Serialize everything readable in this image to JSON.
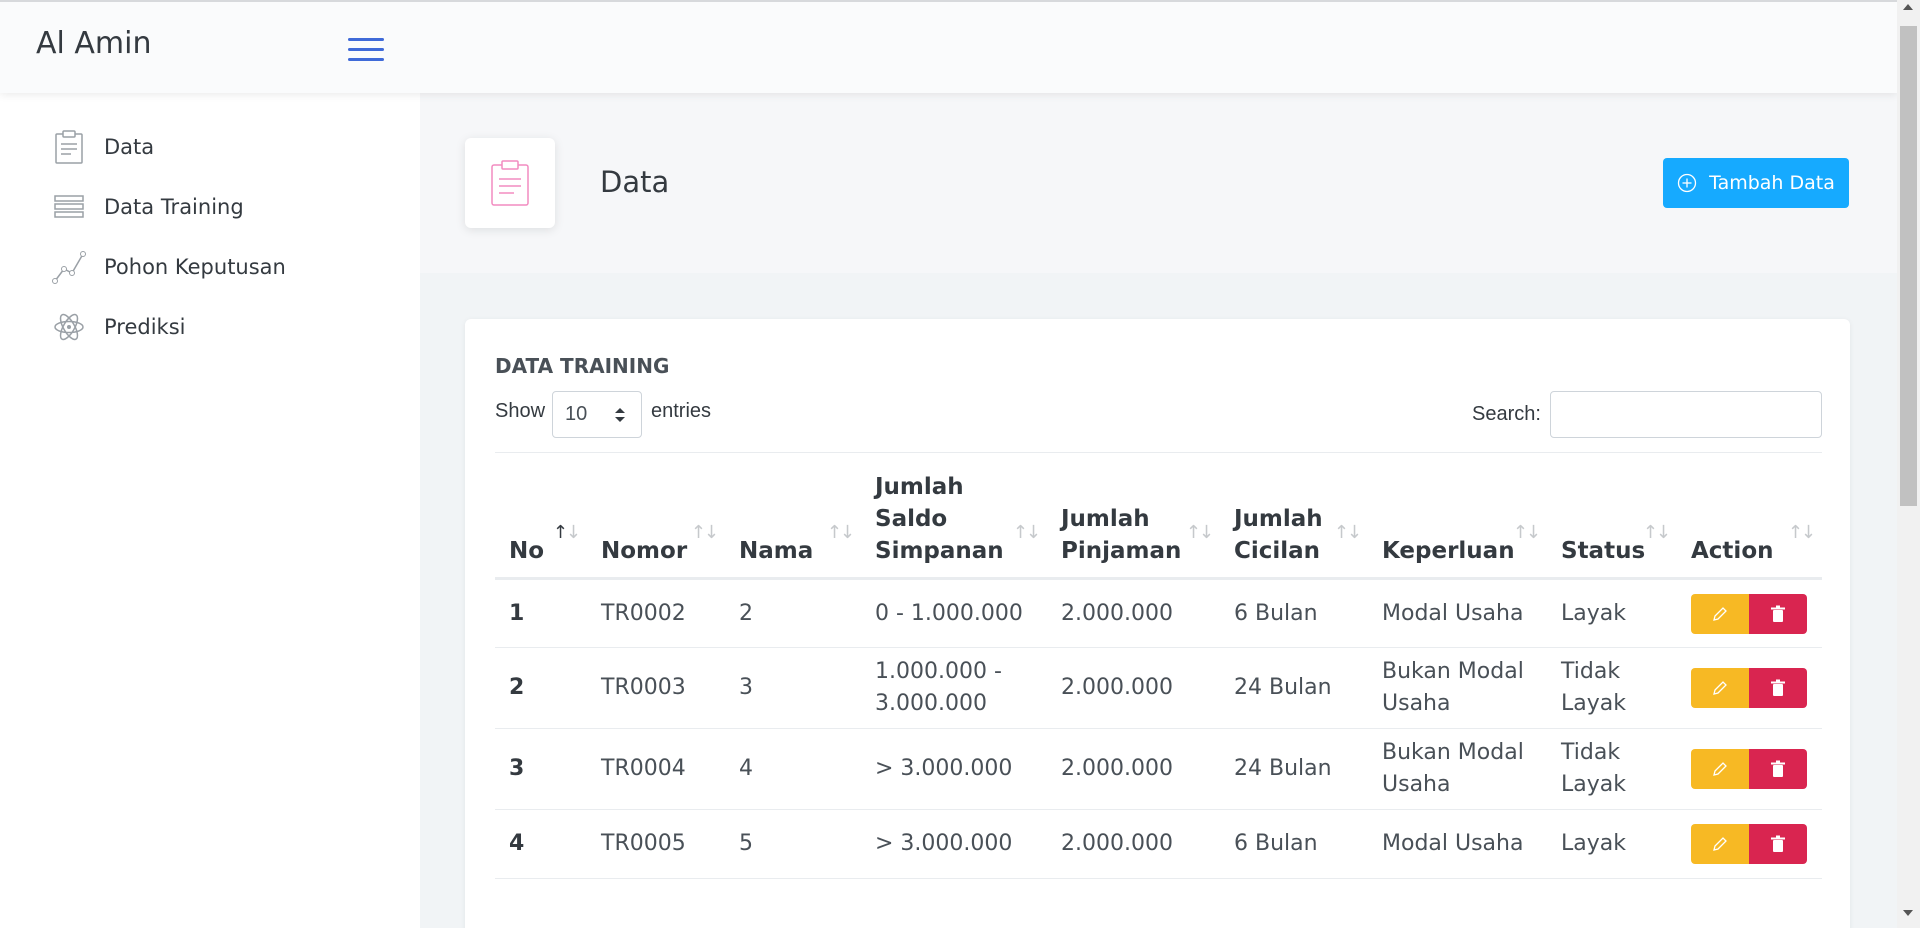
{
  "app": {
    "brand": "Al Amin"
  },
  "sidebar": {
    "items": [
      {
        "label": "Data",
        "icon": "clipboard-icon"
      },
      {
        "label": "Data Training",
        "icon": "list-icon"
      },
      {
        "label": "Pohon Keputusan",
        "icon": "graph-icon"
      },
      {
        "label": "Prediksi",
        "icon": "atom-icon"
      }
    ]
  },
  "page": {
    "title": "Data",
    "add_button": "Tambah Data"
  },
  "card": {
    "title": "DATA TRAINING",
    "show_label": "Show",
    "entries_value": "10",
    "entries_label": "entries",
    "search_label": "Search:",
    "search_value": ""
  },
  "table": {
    "headers": [
      "No",
      "Nomor",
      "Nama",
      "Jumlah Saldo Simpanan",
      "Jumlah Pinjaman",
      "Jumlah Cicilan",
      "Keperluan",
      "Status",
      "Action"
    ],
    "rows": [
      {
        "no": "1",
        "nomor": "TR0002",
        "nama": "2",
        "saldo": "0 - 1.000.000",
        "pinjaman": "2.000.000",
        "cicilan": "6 Bulan",
        "keperluan": "Modal Usaha",
        "status": "Layak"
      },
      {
        "no": "2",
        "nomor": "TR0003",
        "nama": "3",
        "saldo": "1.000.000 - 3.000.000",
        "pinjaman": "2.000.000",
        "cicilan": "24 Bulan",
        "keperluan": "Bukan Modal Usaha",
        "status": "Tidak Layak"
      },
      {
        "no": "3",
        "nomor": "TR0004",
        "nama": "4",
        "saldo": "> 3.000.000",
        "pinjaman": "2.000.000",
        "cicilan": "24 Bulan",
        "keperluan": "Bukan Modal Usaha",
        "status": "Tidak Layak"
      },
      {
        "no": "4",
        "nomor": "TR0005",
        "nama": "5",
        "saldo": "> 3.000.000",
        "pinjaman": "2.000.000",
        "cicilan": "6 Bulan",
        "keperluan": "Modal Usaha",
        "status": "Layak"
      }
    ]
  },
  "colors": {
    "primary": "#3f6ad8",
    "info": "#16aaff",
    "warning": "#f7b924",
    "danger": "#d92550"
  }
}
